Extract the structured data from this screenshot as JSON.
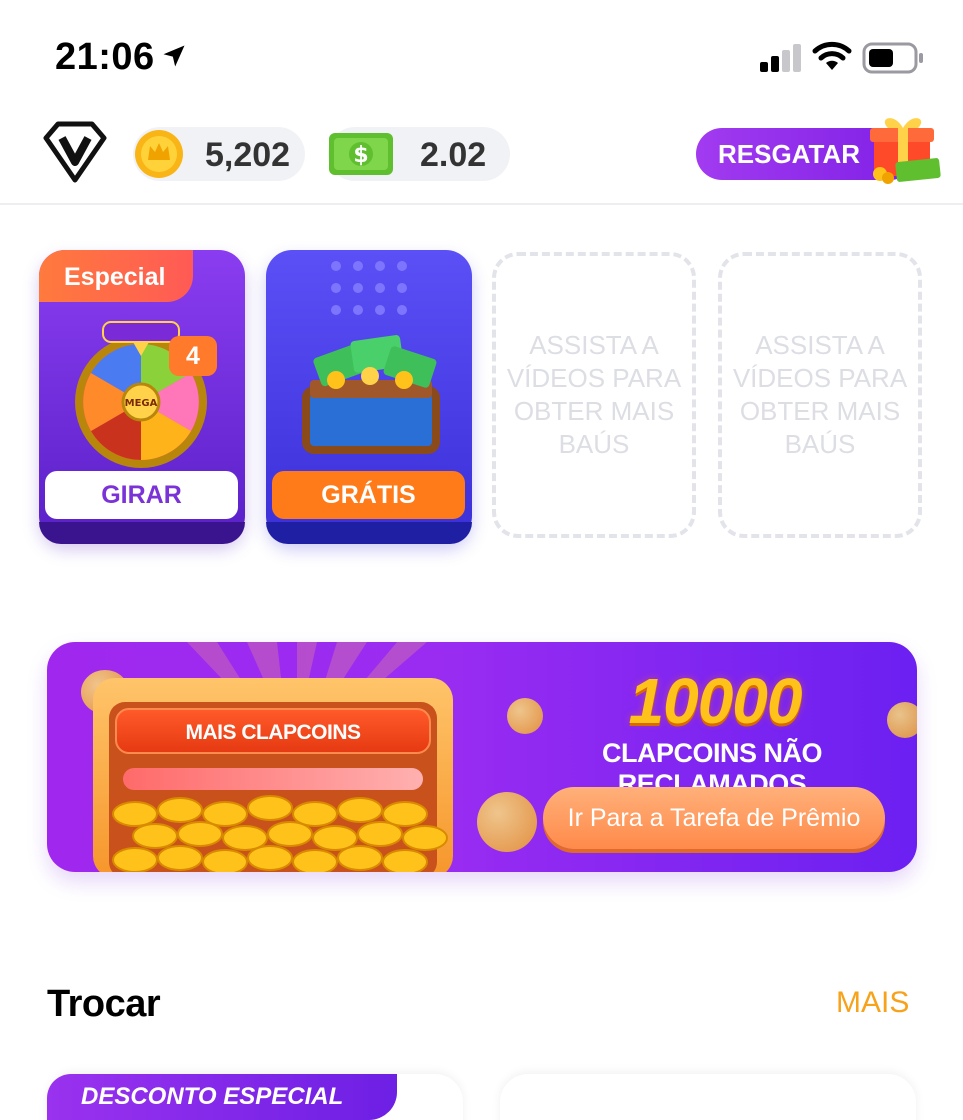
{
  "status_bar": {
    "time": "21:06"
  },
  "header": {
    "coins": "5,202",
    "cash": "2.02",
    "redeem_label": "RESGATAR"
  },
  "chests": {
    "special_tag": "Especial",
    "spin_count": "4",
    "spin_label": "GIRAR",
    "wheel_caption": "MEGA",
    "free_label": "GRÁTIS",
    "empty_slot_text": "ASSISTA A VÍDEOS PARA OBTER MAIS BAÚS"
  },
  "banner": {
    "chest_label": "MAIS CLAPCOINS",
    "amount": "10000",
    "text": "CLAPCOINS NÃO RECLAMADOS",
    "button_label": "Ir Para a Tarefa de Prêmio"
  },
  "exchange": {
    "title": "Trocar",
    "more_label": "MAIS",
    "discount_tag": "DESCONTO ESPECIAL"
  },
  "colors": {
    "accent_purple": "#8a2be2",
    "accent_orange": "#ff7a18",
    "more_link": "#f7a21b"
  },
  "icons": [
    "location-arrow-icon",
    "signal-icon",
    "wifi-icon",
    "battery-icon",
    "vip-icon",
    "coin-icon",
    "cash-icon",
    "gift-icon"
  ]
}
